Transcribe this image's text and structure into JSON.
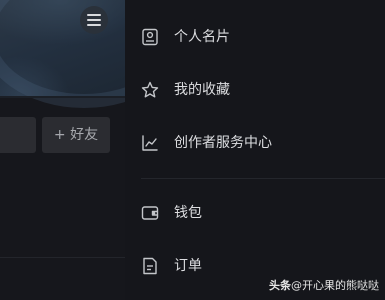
{
  "left": {
    "add_friend_label": "+ 好友"
  },
  "drawer": {
    "items": [
      {
        "label": "个人名片",
        "icon": "id-card-icon"
      },
      {
        "label": "我的收藏",
        "icon": "star-icon"
      },
      {
        "label": "创作者服务中心",
        "icon": "chart-line-icon"
      },
      {
        "label": "钱包",
        "icon": "wallet-icon"
      },
      {
        "label": "订单",
        "icon": "order-document-icon"
      }
    ]
  },
  "watermark": {
    "brand": "头条",
    "handle": "@开心果的熊哒哒"
  },
  "colors": {
    "background": "#15161b",
    "text": "#dcdde0",
    "icon": "#c4c6ca",
    "button": "#2b2c31"
  }
}
